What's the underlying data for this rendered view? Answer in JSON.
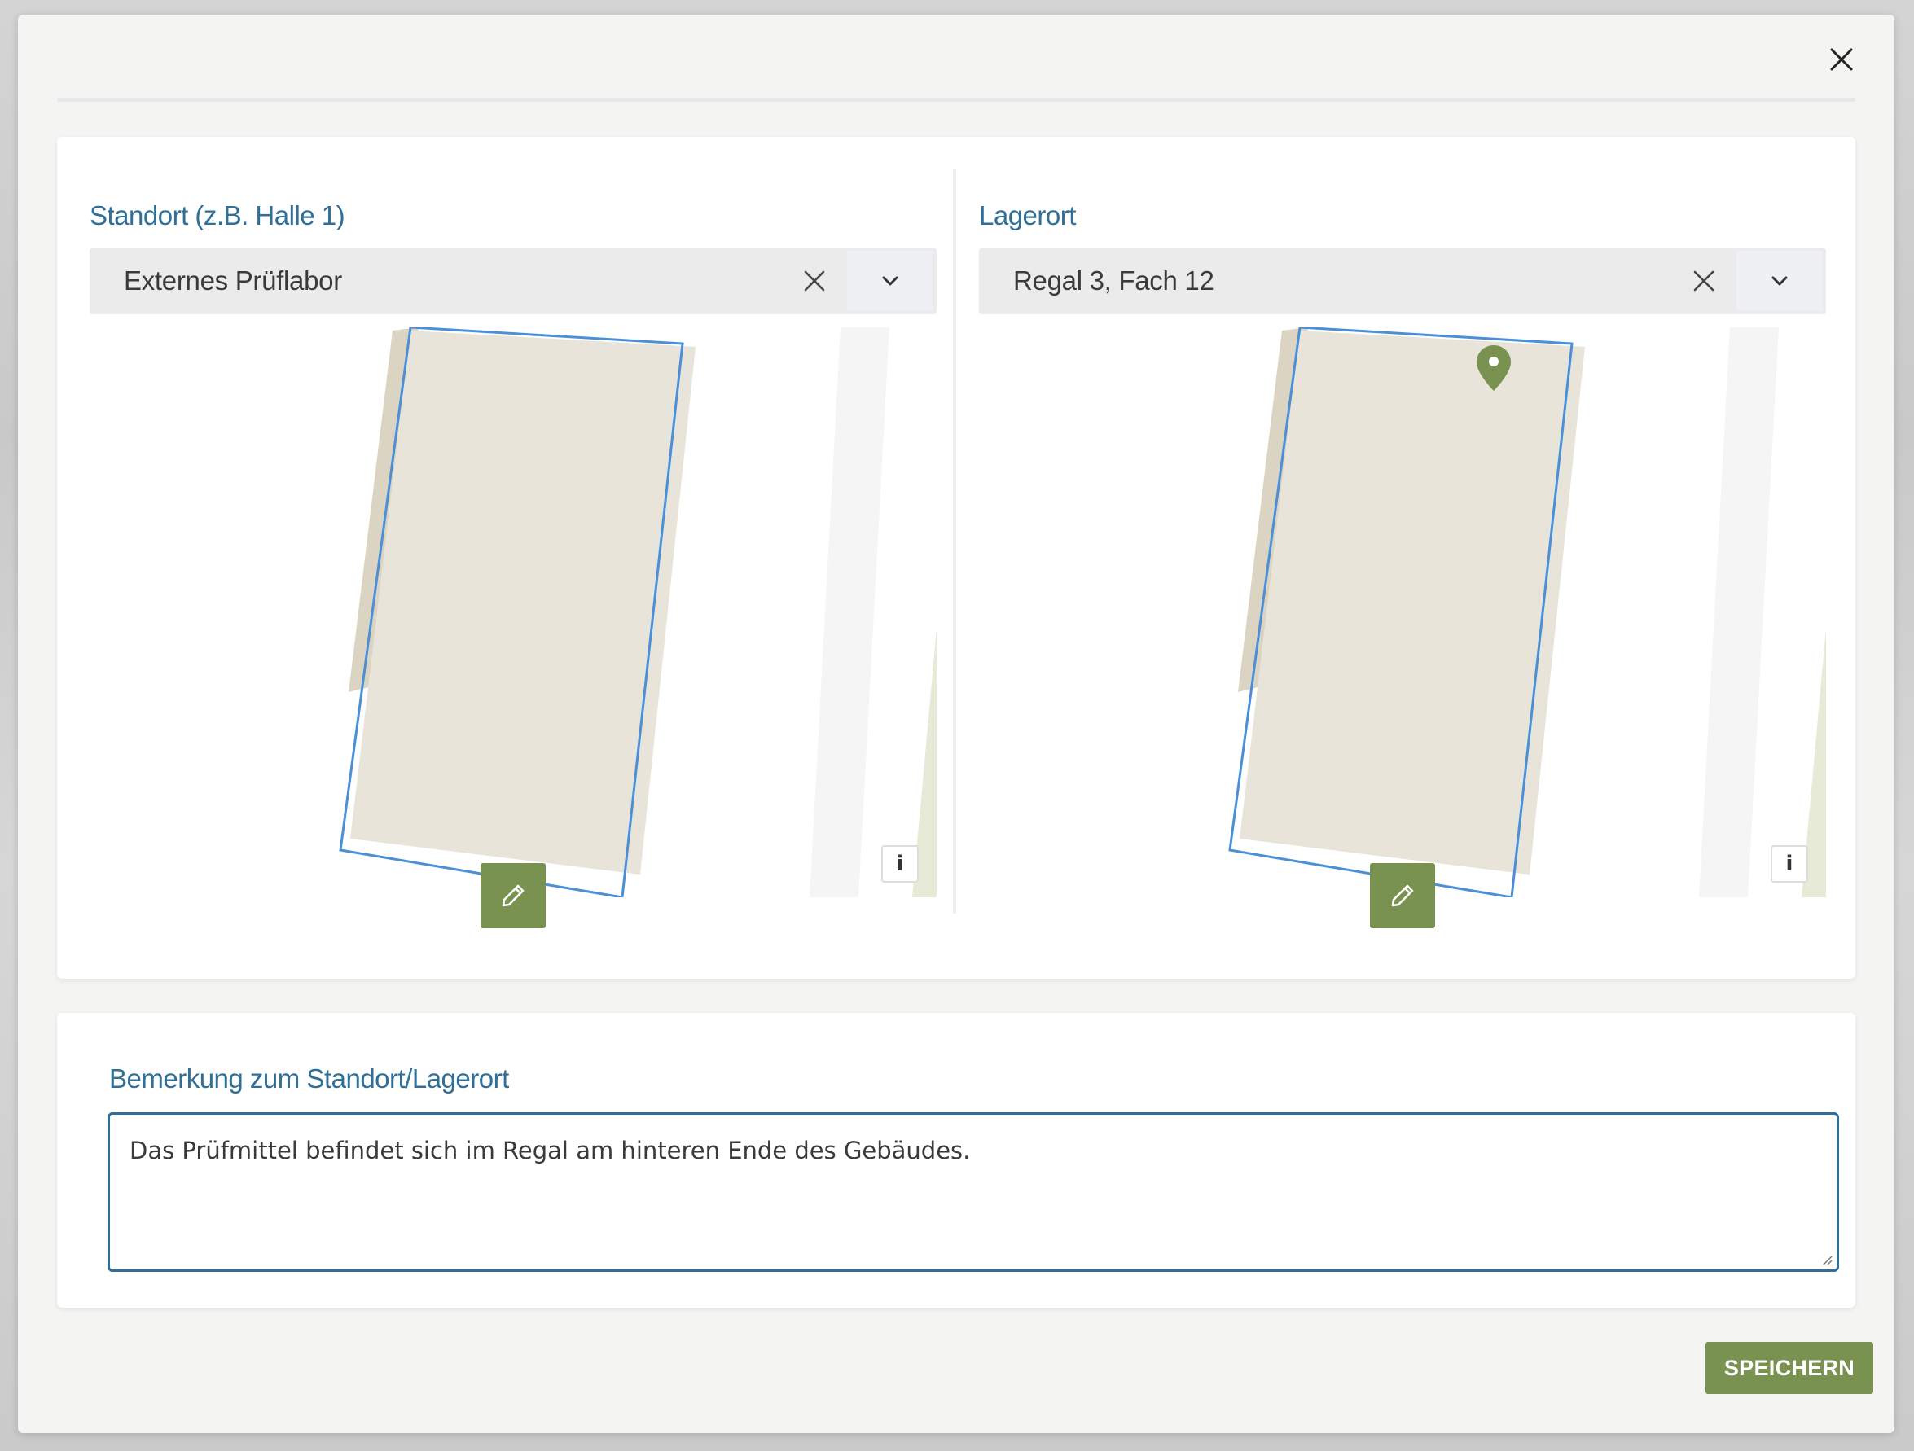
{
  "location_field": {
    "label": "Standort (z.B. Halle 1)",
    "value": "Externes Prüflabor"
  },
  "storage_field": {
    "label": "Lagerort",
    "value": "Regal 3, Fach 12"
  },
  "remark_field": {
    "label": "Bemerkung zum Standort/Lagerort",
    "value": "Das Prüfmittel befindet sich im Regal am hinteren Ende des Gebäudes."
  },
  "map": {
    "info_label": "i"
  },
  "actions": {
    "save_label": "SPEICHERN"
  },
  "colors": {
    "accent_blue": "#2f6f98",
    "accent_green": "#7a9250",
    "building_fill": "#e8e4da",
    "building_outline": "#4a90d9"
  }
}
